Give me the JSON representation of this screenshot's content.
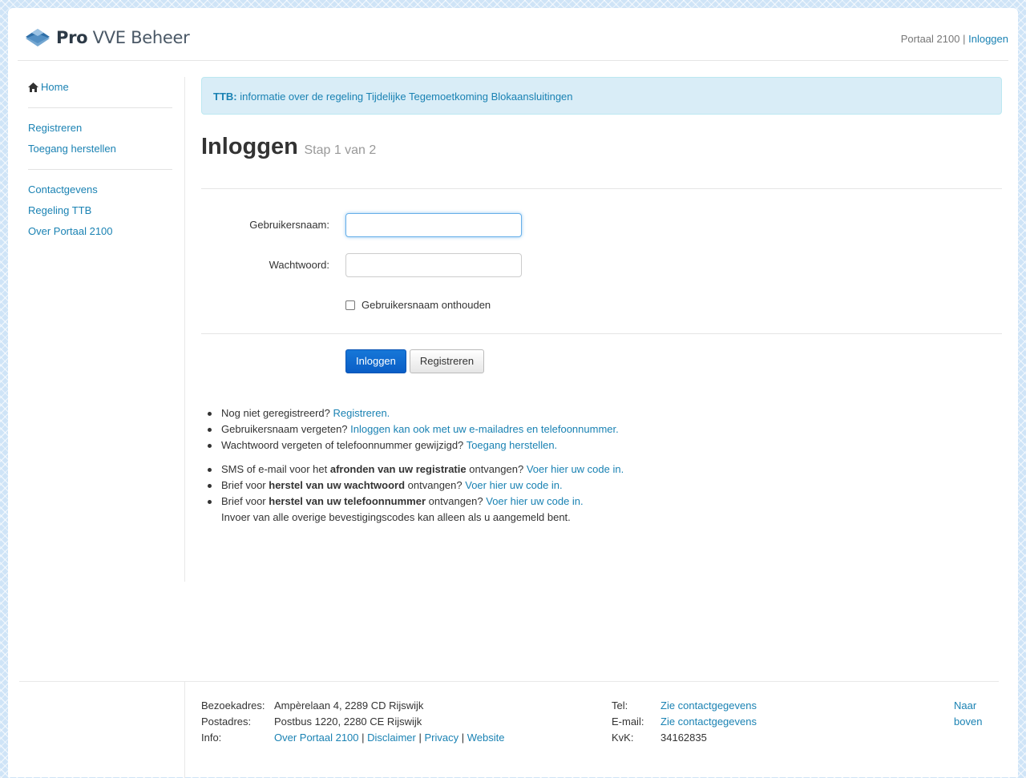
{
  "header": {
    "logo_bold": "Pro",
    "logo_rest": "VVE Beheer",
    "portal_label": "Portaal 2100",
    "separator": "|",
    "login_link": "Inloggen"
  },
  "sidebar": {
    "home": "Home",
    "items_group1": [
      "Registreren",
      "Toegang herstellen"
    ],
    "items_group2": [
      "Contactgevens",
      "Regeling TTB",
      "Over Portaal 2100"
    ]
  },
  "alert": {
    "prefix": "TTB:",
    "text": "informatie over de regeling Tijdelijke Tegemoetkoming Blokaansluitingen"
  },
  "page": {
    "title": "Inloggen",
    "subtitle": "Stap 1 van 2"
  },
  "form": {
    "username_label": "Gebruikersnaam:",
    "username_value": "",
    "password_label": "Wachtwoord:",
    "password_value": "",
    "remember_label": "Gebruikersnaam onthouden",
    "remember_checked": false,
    "login_button": "Inloggen",
    "register_button": "Registreren"
  },
  "help": {
    "l1_text": "Nog niet geregistreerd?",
    "l1_link": "Registreren.",
    "l2_text": "Gebruikersnaam vergeten?",
    "l2_link": "Inloggen kan ook met uw e-mailadres en telefoonnummer.",
    "l3_text": "Wachtwoord vergeten of telefoonnummer gewijzigd?",
    "l3_link": "Toegang herstellen.",
    "l4_pre": "SMS of e-mail voor het",
    "l4_bold": "afronden van uw registratie",
    "l4_post": "ontvangen?",
    "l4_link": "Voer hier uw code in.",
    "l5_pre": "Brief voor",
    "l5_bold": "herstel van uw wachtwoord",
    "l5_post": "ontvangen?",
    "l5_link": "Voer hier uw code in.",
    "l6_pre": "Brief voor",
    "l6_bold": "herstel van uw telefoonnummer",
    "l6_post": "ontvangen?",
    "l6_link": "Voer hier uw code in.",
    "l7_text": "Invoer van alle overige bevestigingscodes kan alleen als u aangemeld bent."
  },
  "footer": {
    "visit_label": "Bezoekadres:",
    "visit_value": "Ampèrelaan 4, 2289 CD Rijswijk",
    "post_label": "Postadres:",
    "post_value": "Postbus 1220, 2280 CE Rijswijk",
    "info_label": "Info:",
    "info_links": [
      "Over Portaal 2100",
      "Disclaimer",
      "Privacy",
      "Website"
    ],
    "info_sep": "|",
    "tel_label": "Tel:",
    "tel_value": "Zie contactgegevens",
    "email_label": "E-mail:",
    "email_value": "Zie contactgegevens",
    "kvk_label": "KvK:",
    "kvk_value": "34162835",
    "top_link_1": "Naar",
    "top_link_2": "boven"
  }
}
